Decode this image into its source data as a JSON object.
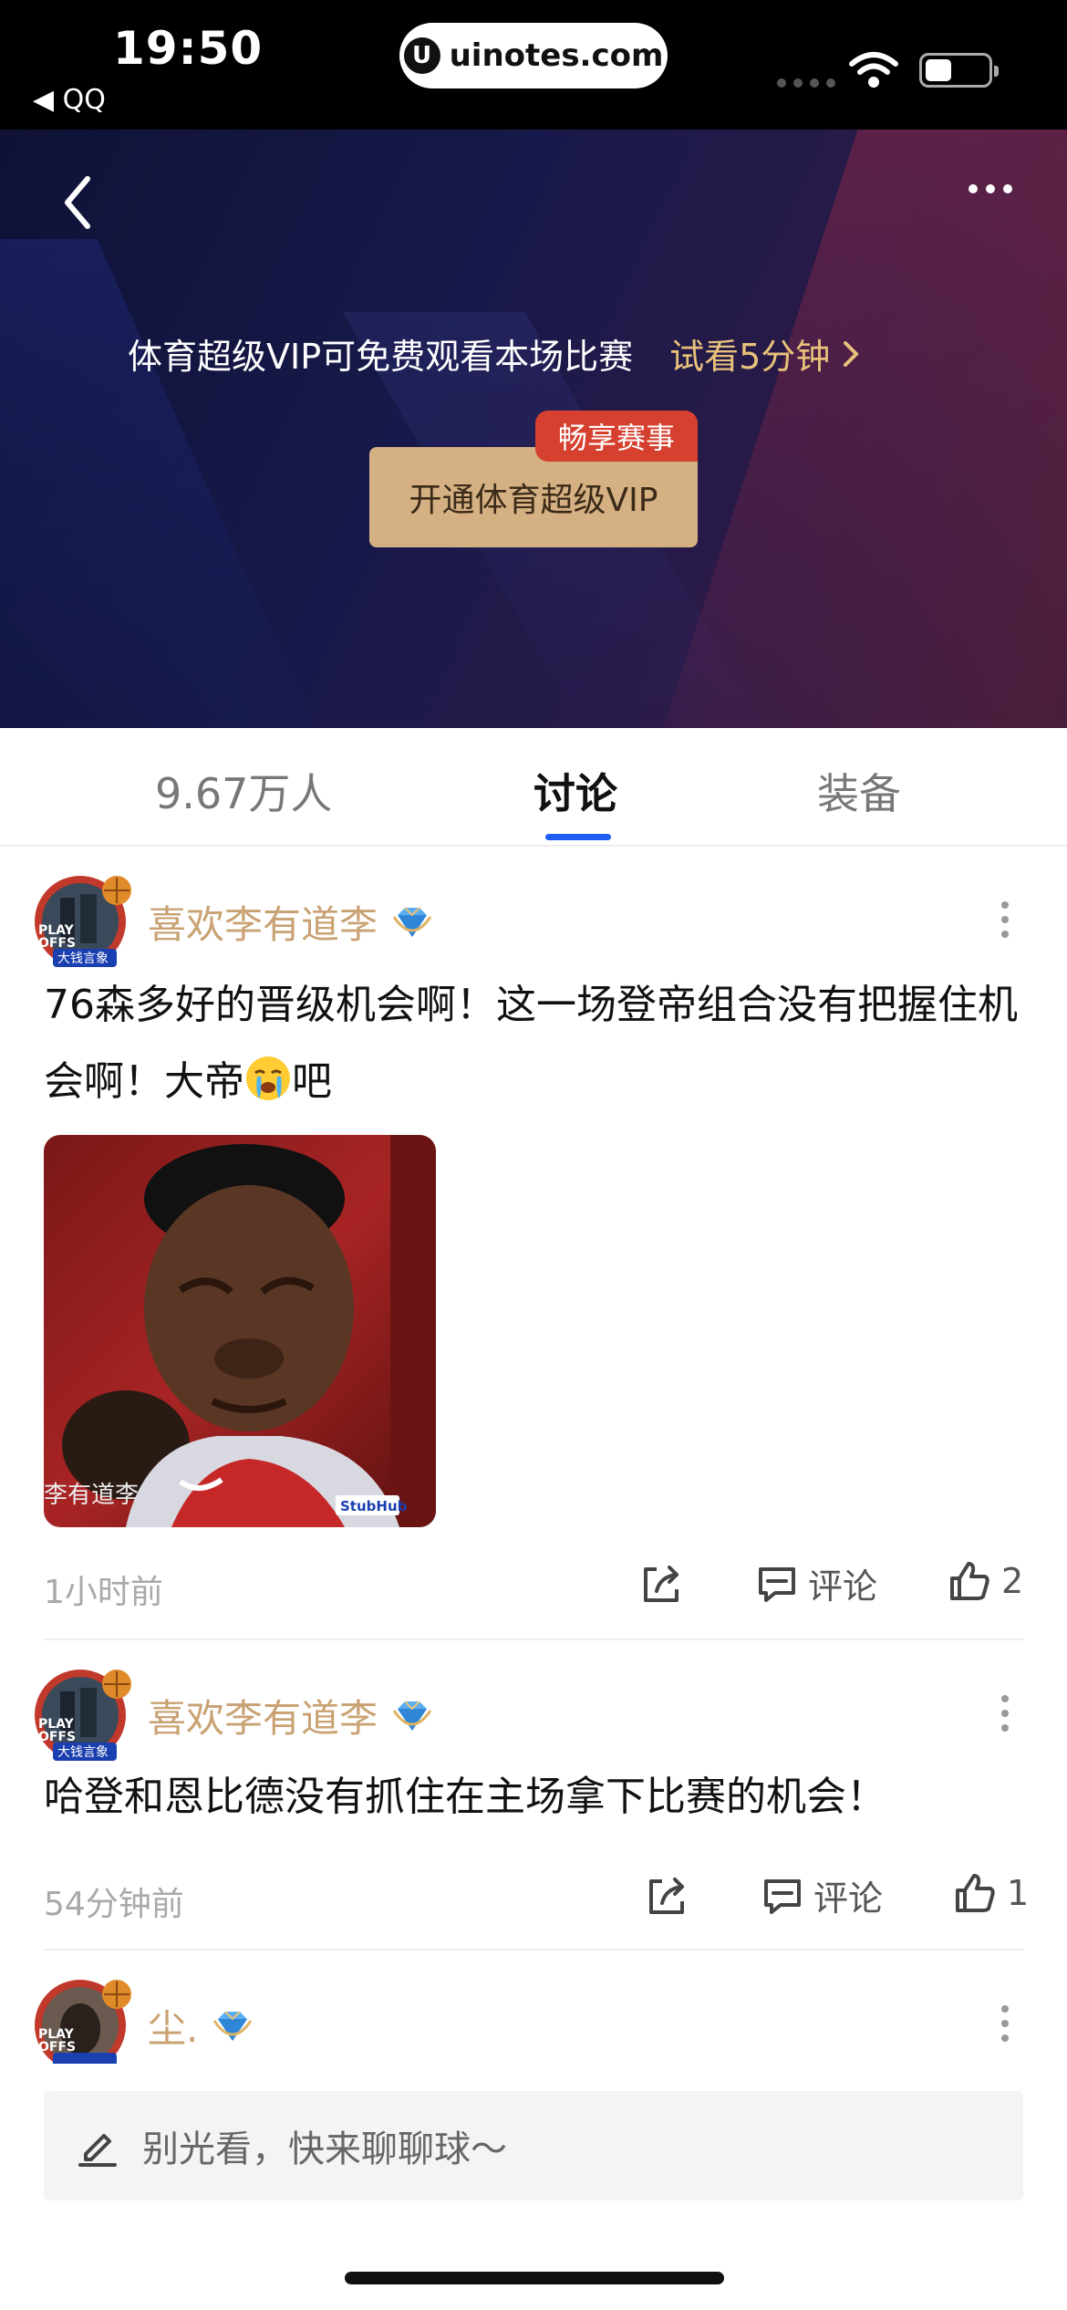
{
  "status_bar": {
    "time": "19:50",
    "back_app": "◀ QQ",
    "url": "uinotes.com",
    "url_logo": "U"
  },
  "hero": {
    "vip_text": "体育超级VIP可免费观看本场比赛",
    "trial_text": "试看5分钟",
    "vip_button": "开通体育超级VIP",
    "vip_badge": "畅享赛事"
  },
  "tabs": [
    {
      "label": "9.67万人"
    },
    {
      "label": "讨论"
    },
    {
      "label": "装备"
    }
  ],
  "posts": [
    {
      "user": "喜欢李有道李",
      "body_part1": "76森多好的晋级机会啊！这一场登帝组合没有把握住机会啊！大帝",
      "body_part2": "吧",
      "image_watermark": "李有道李",
      "time": "1小时前",
      "comment_label": "评论",
      "likes": "2"
    },
    {
      "user": "喜欢李有道李",
      "body": "哈登和恩比德没有抓住在主场拿下比赛的机会！",
      "time": "54分钟前",
      "comment_label": "评论",
      "likes": "1"
    },
    {
      "user": "尘."
    }
  ],
  "avatar_text": {
    "playoffs": "PLAY\nOFFS",
    "tag": "大钱言象"
  },
  "composer": {
    "placeholder": "别光看，快来聊聊球～"
  },
  "colors": {
    "accent_blue": "#1f5ef5",
    "gold_text": "#c9a273",
    "vip_button": "#d4b082",
    "badge_red": "#d6402f"
  },
  "icons": [
    "back-chevron-icon",
    "more-icon",
    "diamond-icon",
    "share-icon",
    "comment-icon",
    "like-icon",
    "pen-icon",
    "wifi-icon",
    "battery-icon"
  ]
}
